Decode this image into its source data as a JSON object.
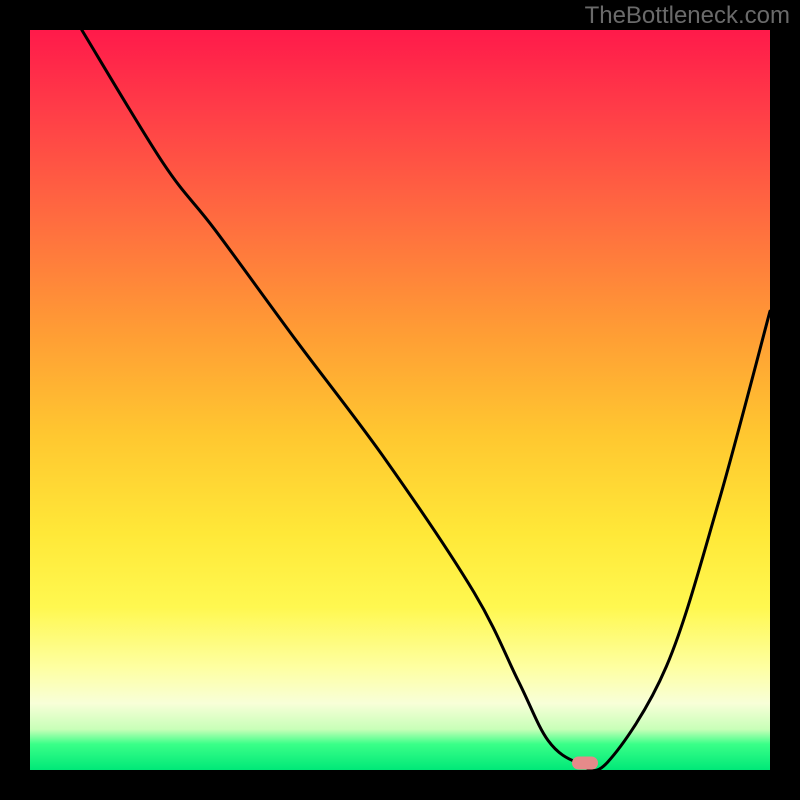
{
  "watermark": "TheBottleneck.com",
  "chart_data": {
    "type": "line",
    "title": "",
    "xlabel": "",
    "ylabel": "",
    "xlim": [
      0,
      100
    ],
    "ylim": [
      0,
      100
    ],
    "grid": false,
    "background_gradient": {
      "top": "#ff1a4a",
      "mid": "#ffe838",
      "bottom": "#00e878"
    },
    "series": [
      {
        "name": "bottleneck-curve",
        "color": "#000000",
        "x": [
          7,
          18,
          25,
          36,
          48,
          60,
          66,
          70,
          74,
          78,
          86,
          93,
          100
        ],
        "values": [
          100,
          82,
          73,
          58,
          42,
          24,
          12,
          4,
          1,
          1,
          14,
          36,
          62
        ]
      }
    ],
    "marker": {
      "name": "optimal-point",
      "x": 75,
      "y": 1,
      "color": "#e58a8a"
    }
  }
}
